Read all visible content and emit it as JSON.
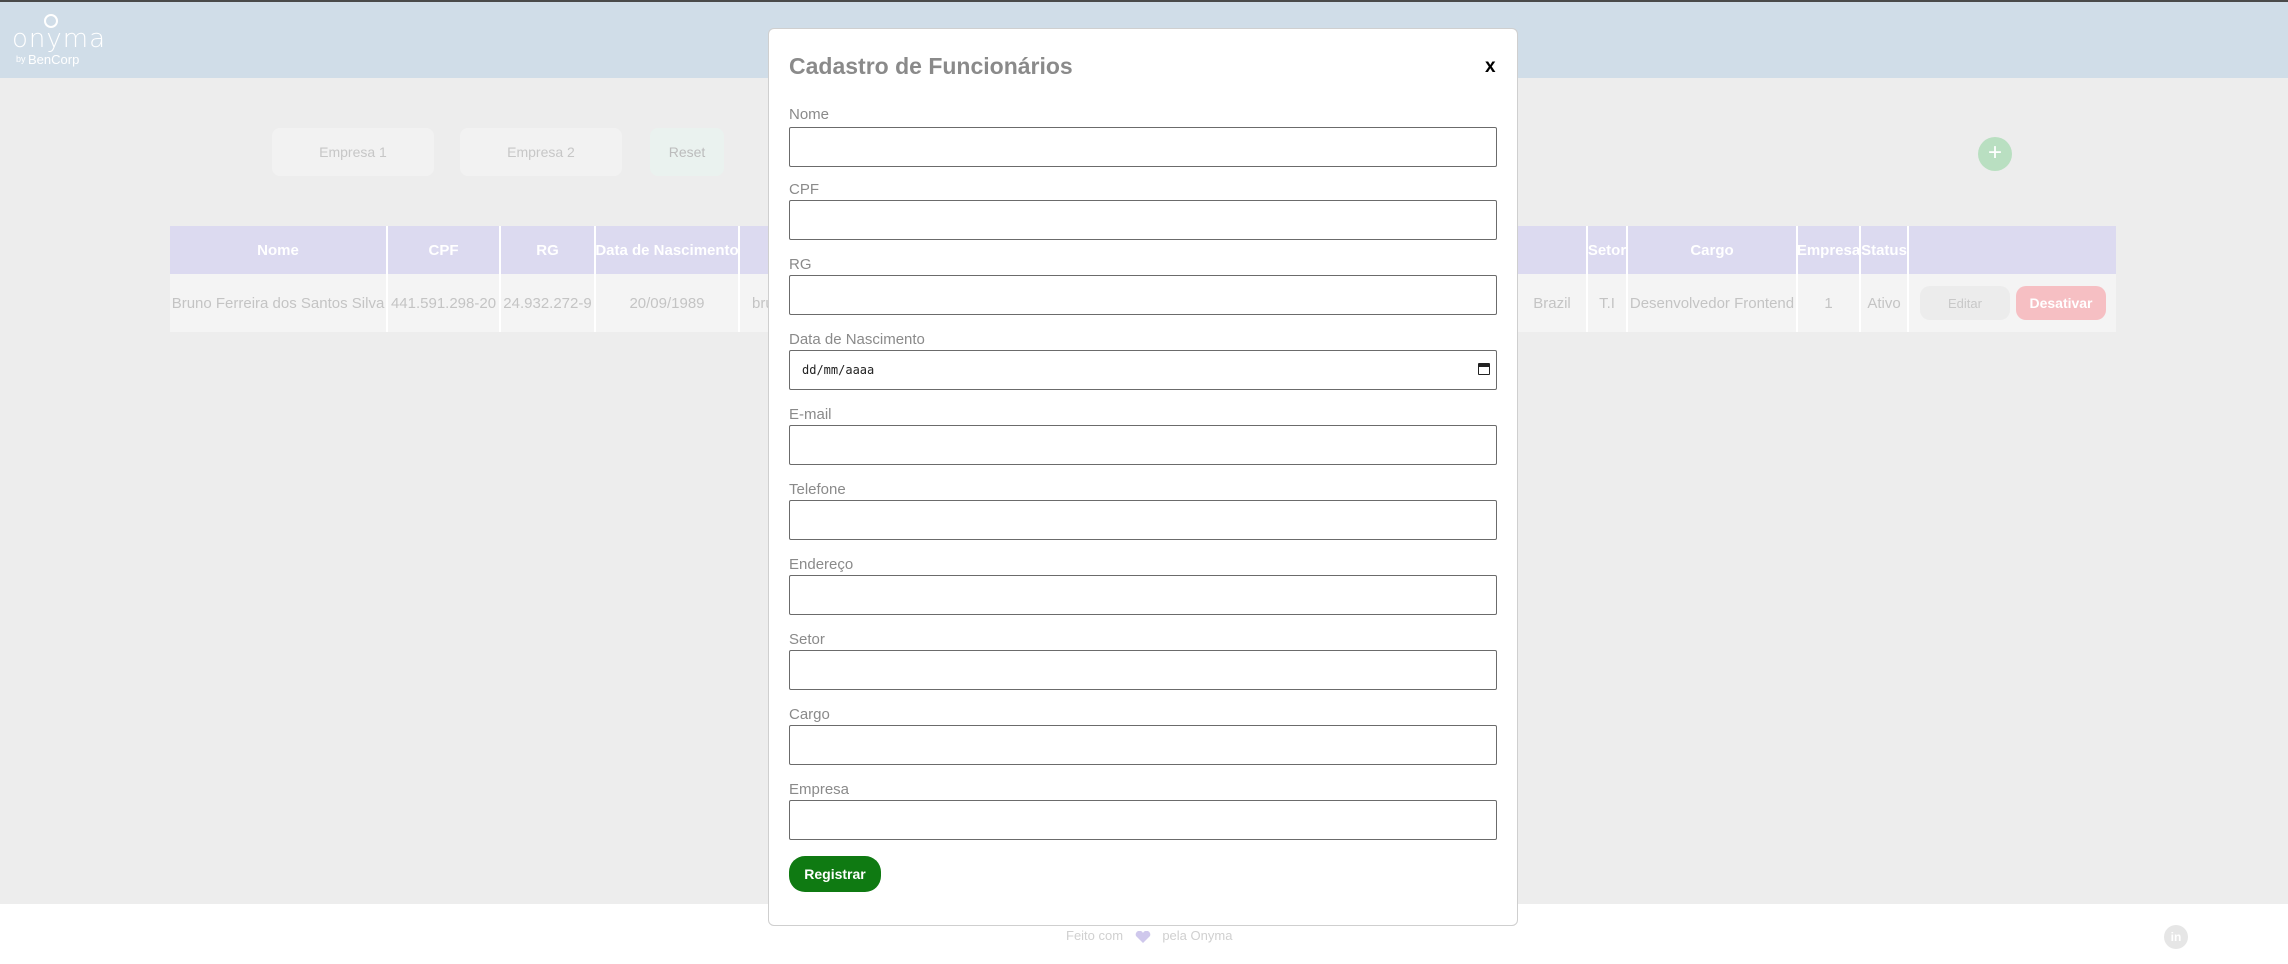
{
  "app": {
    "logo_name": "onyma",
    "logo_by": "by",
    "logo_sub": "BenCorp"
  },
  "filters": {
    "company1": "Empresa 1",
    "company2": "Empresa 2",
    "reset": "Reset",
    "add": "+"
  },
  "table": {
    "headers": [
      "Nome",
      "CPF",
      "RG",
      "Data de Nascimento",
      "",
      "",
      "Setor",
      "Cargo",
      "Empresa",
      "Status"
    ],
    "row": {
      "nome": "Bruno Ferreira dos Santos Silva",
      "cpf": "441.591.298-20",
      "rg": "24.932.272-9",
      "nascimento": "20/09/1989",
      "email_partial": "bru",
      "pais": "Brazil",
      "setor": "T.I",
      "cargo": "Desenvolvedor Frontend",
      "empresa": "1",
      "status": "Ativo",
      "edit": "Editar",
      "deactivate": "Desativar"
    }
  },
  "modal": {
    "title": "Cadastro de Funcionários",
    "close": "x",
    "fields": [
      {
        "label": "Nome",
        "value": ""
      },
      {
        "label": "CPF",
        "value": ""
      },
      {
        "label": "RG",
        "value": ""
      },
      {
        "label": "Data de Nascimento",
        "value": "dd/mm/aaaa"
      },
      {
        "label": "E-mail",
        "value": ""
      },
      {
        "label": "Telefone",
        "value": ""
      },
      {
        "label": "Endereço",
        "value": ""
      },
      {
        "label": "Setor",
        "value": ""
      },
      {
        "label": "Cargo",
        "value": ""
      },
      {
        "label": "Empresa",
        "value": ""
      }
    ],
    "submit": "Registrar"
  },
  "footer": {
    "made_with": "Feito com",
    "by": "pela Onyma",
    "linkedin": "in"
  }
}
